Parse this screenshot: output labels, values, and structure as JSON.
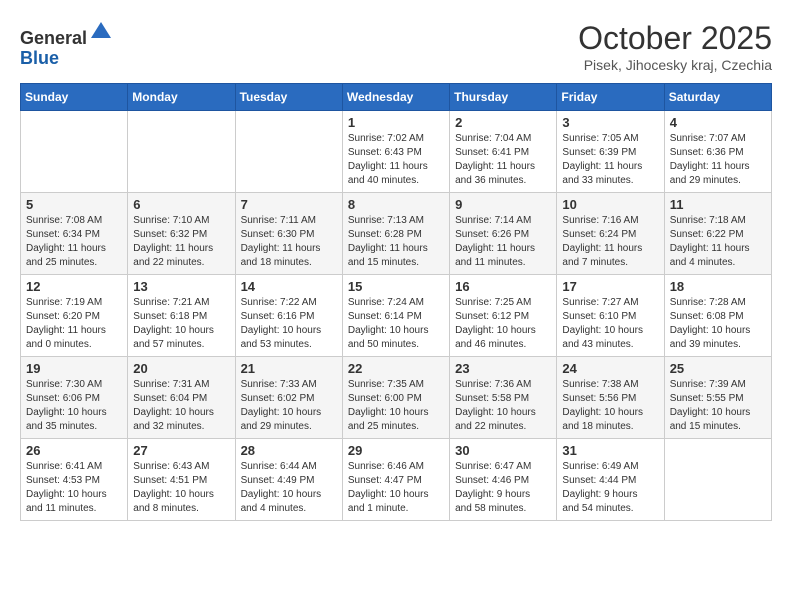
{
  "header": {
    "logo_general": "General",
    "logo_blue": "Blue",
    "month_title": "October 2025",
    "location": "Pisek, Jihocesky kraj, Czechia"
  },
  "weekdays": [
    "Sunday",
    "Monday",
    "Tuesday",
    "Wednesday",
    "Thursday",
    "Friday",
    "Saturday"
  ],
  "weeks": [
    [
      {
        "day": "",
        "info": ""
      },
      {
        "day": "",
        "info": ""
      },
      {
        "day": "",
        "info": ""
      },
      {
        "day": "1",
        "info": "Sunrise: 7:02 AM\nSunset: 6:43 PM\nDaylight: 11 hours\nand 40 minutes."
      },
      {
        "day": "2",
        "info": "Sunrise: 7:04 AM\nSunset: 6:41 PM\nDaylight: 11 hours\nand 36 minutes."
      },
      {
        "day": "3",
        "info": "Sunrise: 7:05 AM\nSunset: 6:39 PM\nDaylight: 11 hours\nand 33 minutes."
      },
      {
        "day": "4",
        "info": "Sunrise: 7:07 AM\nSunset: 6:36 PM\nDaylight: 11 hours\nand 29 minutes."
      }
    ],
    [
      {
        "day": "5",
        "info": "Sunrise: 7:08 AM\nSunset: 6:34 PM\nDaylight: 11 hours\nand 25 minutes."
      },
      {
        "day": "6",
        "info": "Sunrise: 7:10 AM\nSunset: 6:32 PM\nDaylight: 11 hours\nand 22 minutes."
      },
      {
        "day": "7",
        "info": "Sunrise: 7:11 AM\nSunset: 6:30 PM\nDaylight: 11 hours\nand 18 minutes."
      },
      {
        "day": "8",
        "info": "Sunrise: 7:13 AM\nSunset: 6:28 PM\nDaylight: 11 hours\nand 15 minutes."
      },
      {
        "day": "9",
        "info": "Sunrise: 7:14 AM\nSunset: 6:26 PM\nDaylight: 11 hours\nand 11 minutes."
      },
      {
        "day": "10",
        "info": "Sunrise: 7:16 AM\nSunset: 6:24 PM\nDaylight: 11 hours\nand 7 minutes."
      },
      {
        "day": "11",
        "info": "Sunrise: 7:18 AM\nSunset: 6:22 PM\nDaylight: 11 hours\nand 4 minutes."
      }
    ],
    [
      {
        "day": "12",
        "info": "Sunrise: 7:19 AM\nSunset: 6:20 PM\nDaylight: 11 hours\nand 0 minutes."
      },
      {
        "day": "13",
        "info": "Sunrise: 7:21 AM\nSunset: 6:18 PM\nDaylight: 10 hours\nand 57 minutes."
      },
      {
        "day": "14",
        "info": "Sunrise: 7:22 AM\nSunset: 6:16 PM\nDaylight: 10 hours\nand 53 minutes."
      },
      {
        "day": "15",
        "info": "Sunrise: 7:24 AM\nSunset: 6:14 PM\nDaylight: 10 hours\nand 50 minutes."
      },
      {
        "day": "16",
        "info": "Sunrise: 7:25 AM\nSunset: 6:12 PM\nDaylight: 10 hours\nand 46 minutes."
      },
      {
        "day": "17",
        "info": "Sunrise: 7:27 AM\nSunset: 6:10 PM\nDaylight: 10 hours\nand 43 minutes."
      },
      {
        "day": "18",
        "info": "Sunrise: 7:28 AM\nSunset: 6:08 PM\nDaylight: 10 hours\nand 39 minutes."
      }
    ],
    [
      {
        "day": "19",
        "info": "Sunrise: 7:30 AM\nSunset: 6:06 PM\nDaylight: 10 hours\nand 35 minutes."
      },
      {
        "day": "20",
        "info": "Sunrise: 7:31 AM\nSunset: 6:04 PM\nDaylight: 10 hours\nand 32 minutes."
      },
      {
        "day": "21",
        "info": "Sunrise: 7:33 AM\nSunset: 6:02 PM\nDaylight: 10 hours\nand 29 minutes."
      },
      {
        "day": "22",
        "info": "Sunrise: 7:35 AM\nSunset: 6:00 PM\nDaylight: 10 hours\nand 25 minutes."
      },
      {
        "day": "23",
        "info": "Sunrise: 7:36 AM\nSunset: 5:58 PM\nDaylight: 10 hours\nand 22 minutes."
      },
      {
        "day": "24",
        "info": "Sunrise: 7:38 AM\nSunset: 5:56 PM\nDaylight: 10 hours\nand 18 minutes."
      },
      {
        "day": "25",
        "info": "Sunrise: 7:39 AM\nSunset: 5:55 PM\nDaylight: 10 hours\nand 15 minutes."
      }
    ],
    [
      {
        "day": "26",
        "info": "Sunrise: 6:41 AM\nSunset: 4:53 PM\nDaylight: 10 hours\nand 11 minutes."
      },
      {
        "day": "27",
        "info": "Sunrise: 6:43 AM\nSunset: 4:51 PM\nDaylight: 10 hours\nand 8 minutes."
      },
      {
        "day": "28",
        "info": "Sunrise: 6:44 AM\nSunset: 4:49 PM\nDaylight: 10 hours\nand 4 minutes."
      },
      {
        "day": "29",
        "info": "Sunrise: 6:46 AM\nSunset: 4:47 PM\nDaylight: 10 hours\nand 1 minute."
      },
      {
        "day": "30",
        "info": "Sunrise: 6:47 AM\nSunset: 4:46 PM\nDaylight: 9 hours\nand 58 minutes."
      },
      {
        "day": "31",
        "info": "Sunrise: 6:49 AM\nSunset: 4:44 PM\nDaylight: 9 hours\nand 54 minutes."
      },
      {
        "day": "",
        "info": ""
      }
    ]
  ]
}
